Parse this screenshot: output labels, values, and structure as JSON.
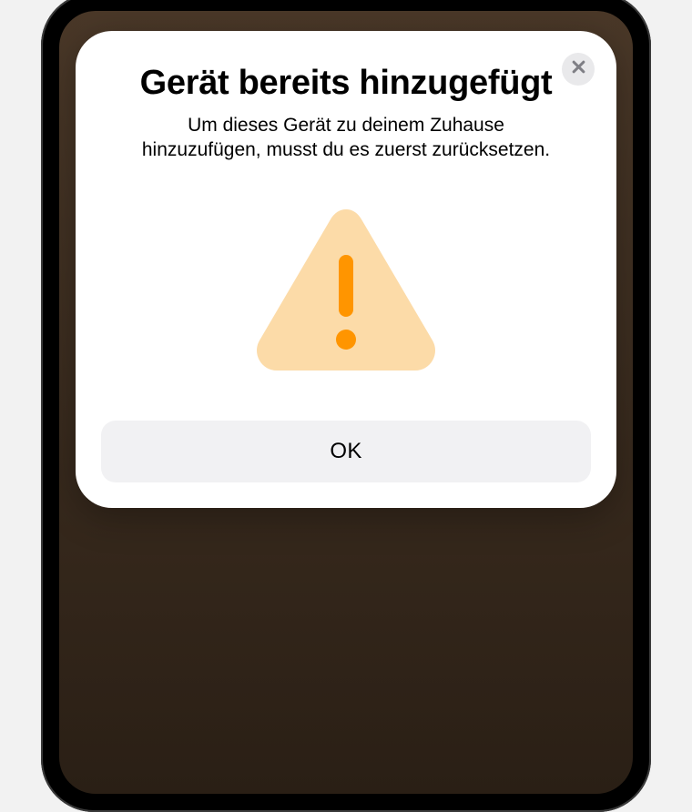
{
  "modal": {
    "title": "Gerät bereits hinzugefügt",
    "subtitle": "Um dieses Gerät zu deinem Zuhause hinzuzufügen, musst du es zuerst zurücksetzen.",
    "ok_label": "OK"
  },
  "icons": {
    "close": "close-icon",
    "warning": "warning-triangle-icon"
  },
  "colors": {
    "warning_fill": "#fcdba8",
    "warning_exclaim": "#ff9500",
    "button_bg": "#f1f1f3",
    "close_bg": "#e9e9eb",
    "close_x": "#7f7f85"
  }
}
